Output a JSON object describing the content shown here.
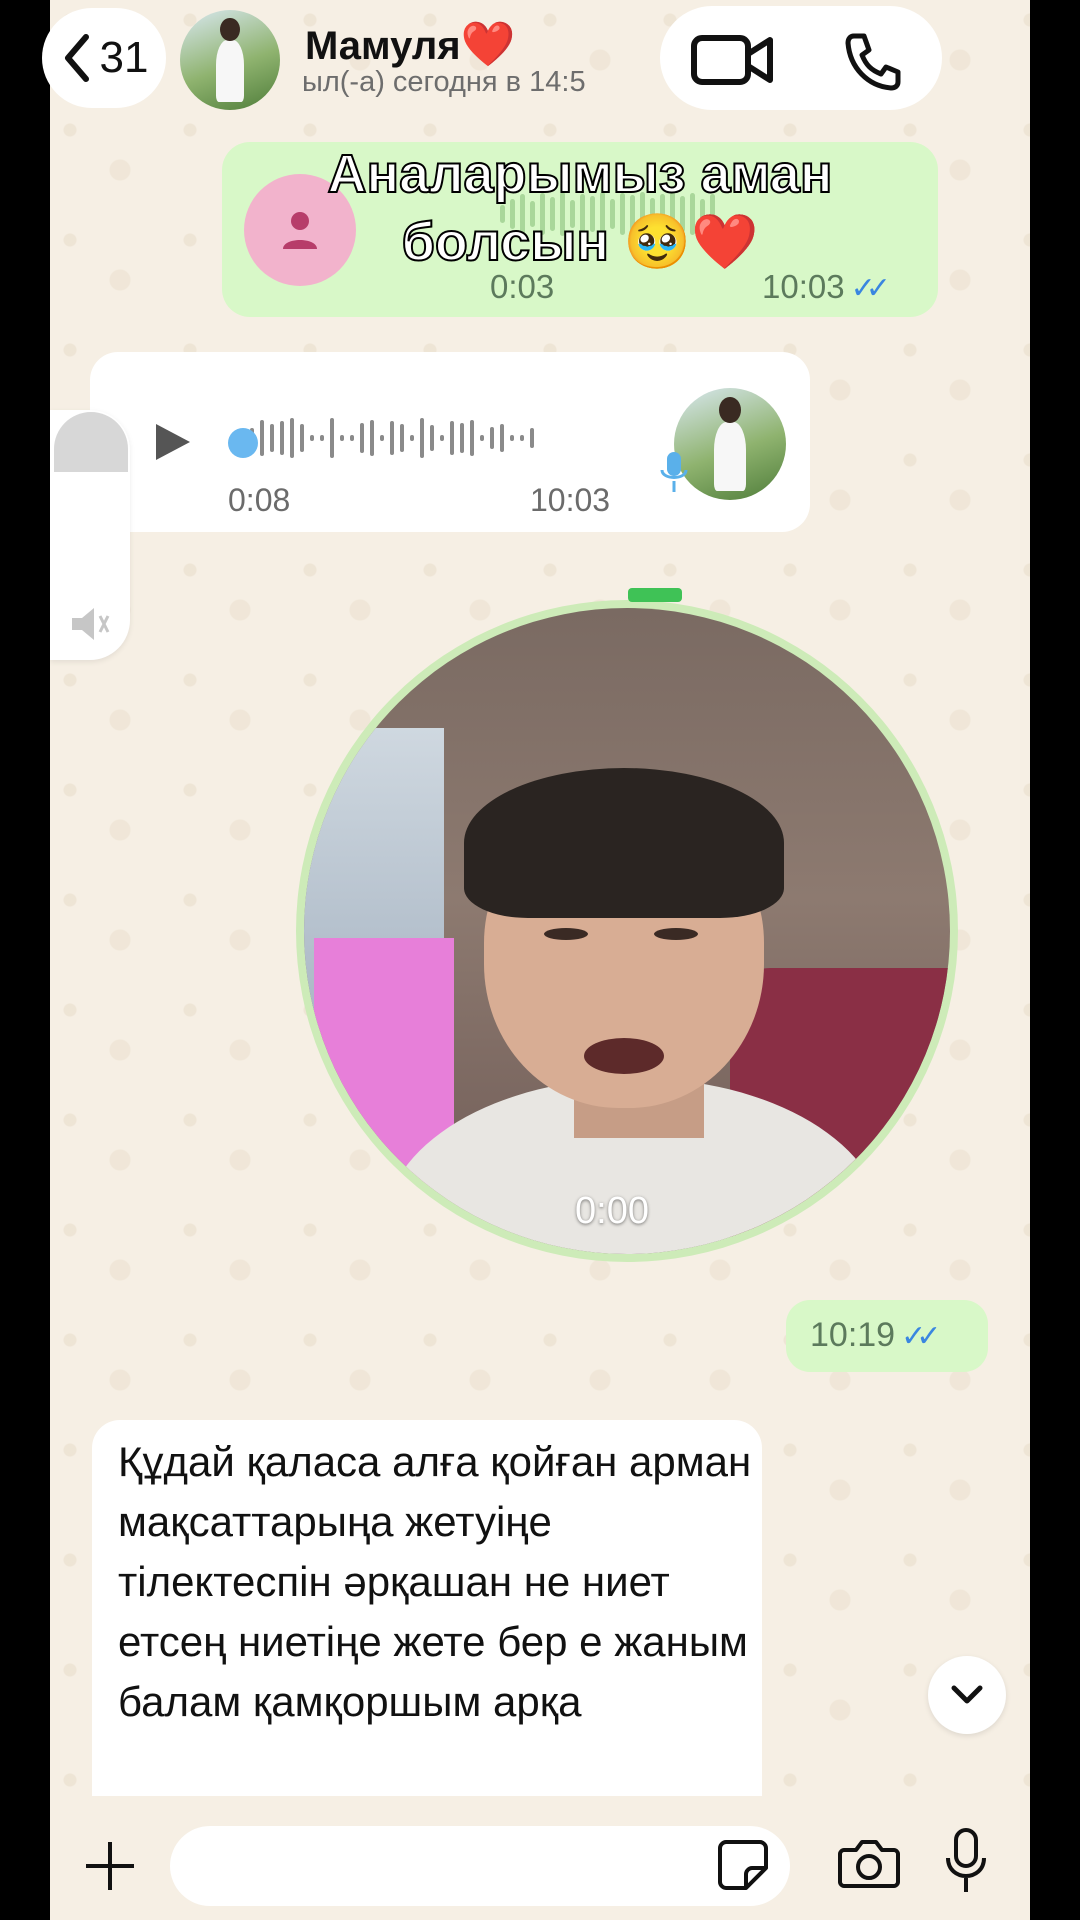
{
  "header": {
    "back_count": "31",
    "contact_name": "Мамуля",
    "contact_emoji": "❤️",
    "status": "ыл(-а) сегодня в 14:5"
  },
  "overlay_caption": "Аналарымыз аман болсын 🥹❤️",
  "messages": [
    {
      "type": "voice",
      "direction": "outgoing",
      "duration": "0:03",
      "time": "10:03",
      "read": true
    },
    {
      "type": "voice",
      "direction": "incoming",
      "duration": "0:08",
      "time": "10:03"
    },
    {
      "type": "video_note",
      "direction": "outgoing",
      "duration": "0:00"
    },
    {
      "type": "time",
      "direction": "outgoing",
      "time": "10:19",
      "read": true
    },
    {
      "type": "text",
      "direction": "incoming",
      "text": "Құдай қаласа алға қойған арман мақсаттарыңа жетуіңе тілектеспін әрқашан не ниет етсең ниетіңе жете бер е жаным балам қамқоршым арқа"
    }
  ],
  "read_ticks": "✓✓",
  "input": {
    "value": "",
    "placeholder": ""
  },
  "colors": {
    "outgoing_bubble": "#d8f8c8",
    "incoming_bubble": "#ffffff",
    "read_tick": "#3a86e0",
    "background": "#f6efe4"
  }
}
